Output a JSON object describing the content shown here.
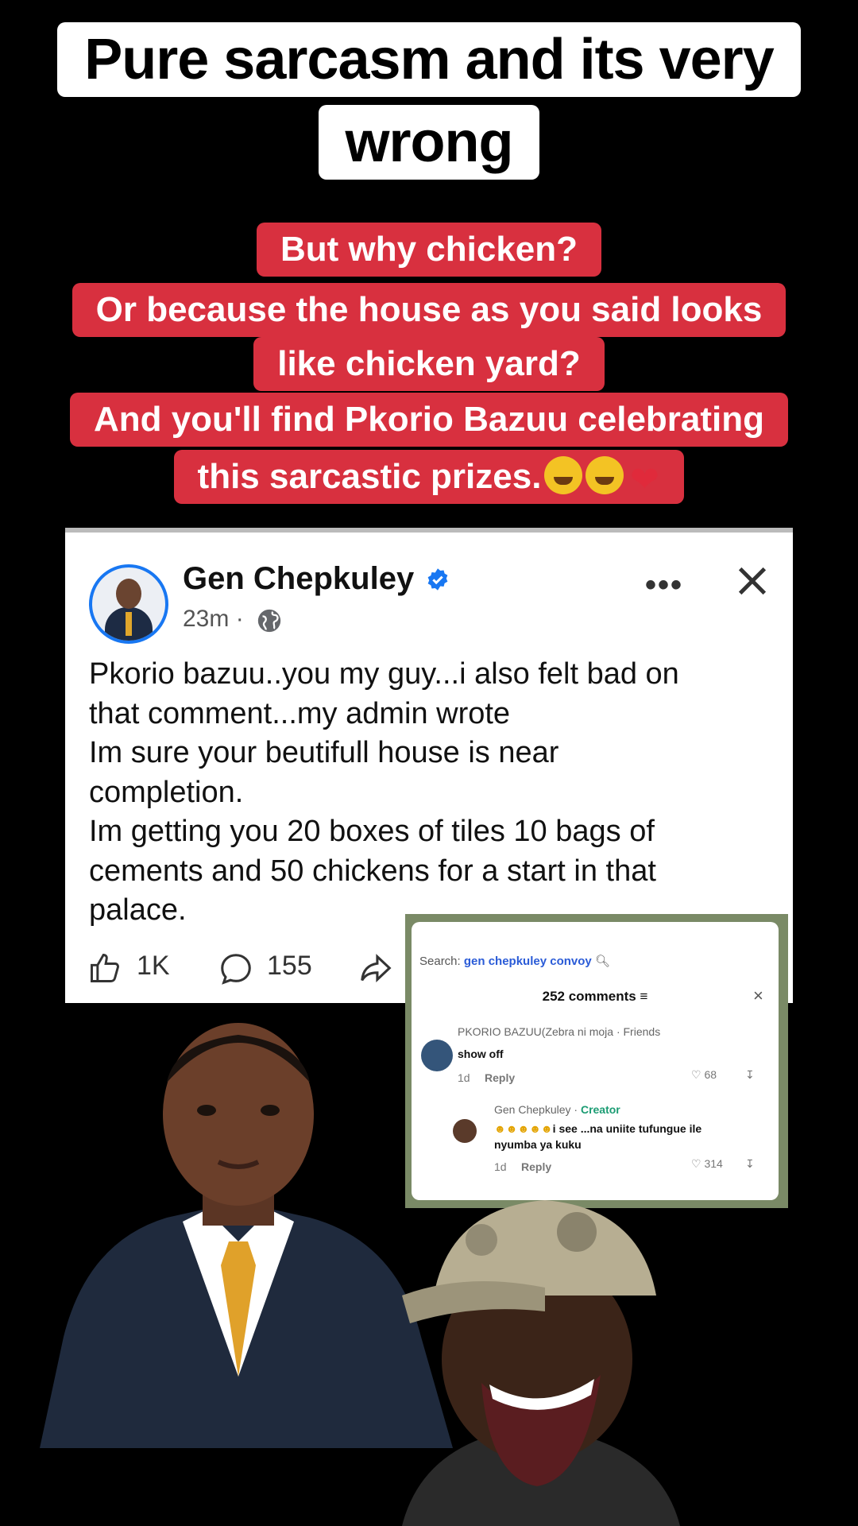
{
  "captions": {
    "title_line1": "Pure sarcasm and its very",
    "title_line2": "wrong",
    "red_lines": [
      "But why chicken?",
      "Or because the house as you said looks",
      "like chicken yard?",
      "And you'll find Pkorio Bazuu celebrating",
      "this sarcastic prizes."
    ]
  },
  "post": {
    "author": "Gen Chepkuley",
    "time": "23m ·",
    "body": "Pkorio bazuu..you my guy...i also felt bad on\nthat comment...my admin wrote\nIm sure your beutifull house is near\ncompletion.\nIm getting you 20 boxes of tiles 10 bags of\ncements and 50 chickens for a start in that\npalace.",
    "likes": "1K",
    "comments": "155",
    "more": "•••"
  },
  "comments_panel": {
    "search_prefix": "Search:",
    "search_query": "gen chepkuley convoy",
    "count_label": "252 comments",
    "close": "×",
    "comment1": {
      "author": "PKORIO BAZUU(Zebra ni moja",
      "suffix": "· Friends",
      "text": "show off",
      "time": "1d",
      "reply": "Reply",
      "likes": "68"
    },
    "comment2": {
      "author": "Gen Chepkuley ·",
      "badge": "Creator",
      "text": "i see ...na uniite tufungue ile nyumba ya kuku",
      "time": "1d",
      "reply": "Reply",
      "likes": "314"
    }
  },
  "colors": {
    "caption_bg": "#ffffff",
    "red_bg": "#d8303f",
    "facebook_blue": "#1877f2",
    "creator_green": "#1b9c73"
  }
}
